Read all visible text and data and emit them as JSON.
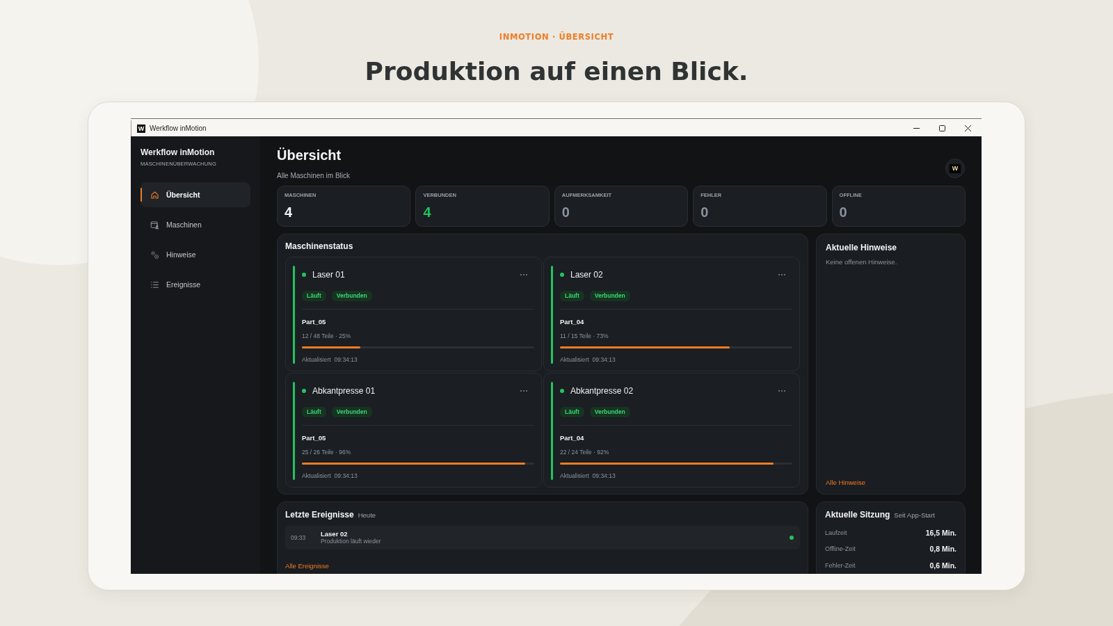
{
  "header": {
    "eyebrow": "INMOTION · ÜBERSICHT",
    "title": "Produktion auf einen Blick."
  },
  "window": {
    "logo": "W",
    "title": "Werkflow inMotion"
  },
  "sidebar": {
    "app_name": "Werkflow inMotion",
    "subtitle": "MASCHINENÜBERWACHUNG",
    "items": [
      {
        "label": "Übersicht",
        "selected": true
      },
      {
        "label": "Maschinen",
        "selected": false
      },
      {
        "label": "Hinweise",
        "selected": false
      },
      {
        "label": "Ereignisse",
        "selected": false
      }
    ]
  },
  "page": {
    "title": "Übersicht",
    "subtitle": "Alle Maschinen im Blick",
    "avatar_logo": "W"
  },
  "stats": [
    {
      "label": "MASCHINEN",
      "value": "4",
      "color": "#f3f4f6"
    },
    {
      "label": "VERBUNDEN",
      "value": "4",
      "color": "#22c55e"
    },
    {
      "label": "AUFMERKSAMKEIT",
      "value": "0",
      "color": "#8a93a0"
    },
    {
      "label": "FEHLER",
      "value": "0",
      "color": "#8a93a0"
    },
    {
      "label": "OFFLINE",
      "value": "0",
      "color": "#8a93a0"
    }
  ],
  "machine_status": {
    "title": "Maschinenstatus",
    "machines": [
      {
        "name": "Laser 01",
        "running": true,
        "tags": [
          "Läuft",
          "Verbunden"
        ],
        "part": "Part_05",
        "progress": "12 / 48 Teile · 25%",
        "level": 0.25,
        "updated_label": "Aktualisiert",
        "updated_time": "09:34:13"
      },
      {
        "name": "Laser 02",
        "running": true,
        "tags": [
          "Läuft",
          "Verbunden"
        ],
        "part": "Part_04",
        "progress": "11 / 15 Teile · 73%",
        "level": 0.73,
        "updated_label": "Aktualisiert",
        "updated_time": "09:34:13"
      },
      {
        "name": "Abkantpresse 01",
        "running": true,
        "tags": [
          "Läuft",
          "Verbunden"
        ],
        "part": "Part_05",
        "progress": "25 / 26 Teile · 96%",
        "level": 0.96,
        "updated_label": "Aktualisiert",
        "updated_time": "09:34:13"
      },
      {
        "name": "Abkantpresse 02",
        "running": true,
        "tags": [
          "Läuft",
          "Verbunden"
        ],
        "part": "Part_04",
        "progress": "22 / 24 Teile · 92%",
        "level": 0.92,
        "updated_label": "Aktualisiert",
        "updated_time": "09:34:13"
      }
    ]
  },
  "notices": {
    "title": "Aktuelle Hinweise",
    "empty_text": "Keine offenen Hinweise.",
    "link": "Alle Hinweise"
  },
  "events": {
    "title": "Letzte Ereignisse",
    "subtitle": "Heute",
    "items": [
      {
        "time": "09:33",
        "title": "Laser 02",
        "text": "Produktion läuft wieder",
        "running": true
      }
    ],
    "link": "Alle Ereignisse"
  },
  "session": {
    "title": "Aktuelle Sitzung",
    "subtitle": "Seit App-Start",
    "rows": [
      {
        "label": "Laufzeit",
        "value": "16,5 Min."
      },
      {
        "label": "Offline-Zeit",
        "value": "0,8 Min."
      },
      {
        "label": "Fehler-Zeit",
        "value": "0,6 Min."
      }
    ]
  }
}
